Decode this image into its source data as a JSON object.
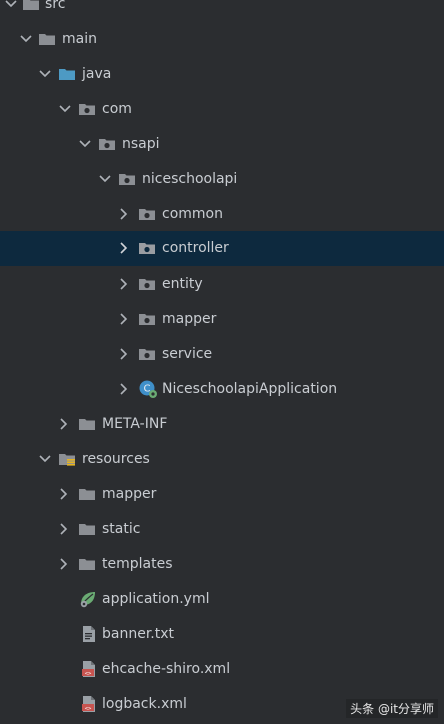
{
  "tree": {
    "items": [
      {
        "label": "src"
      },
      {
        "label": "main"
      },
      {
        "label": "java"
      },
      {
        "label": "com"
      },
      {
        "label": "nsapi"
      },
      {
        "label": "niceschoolapi"
      },
      {
        "label": "common"
      },
      {
        "label": "controller"
      },
      {
        "label": "entity"
      },
      {
        "label": "mapper"
      },
      {
        "label": "service"
      },
      {
        "label": "NiceschoolapiApplication"
      },
      {
        "label": "META-INF"
      },
      {
        "label": "resources"
      },
      {
        "label": "mapper"
      },
      {
        "label": "static"
      },
      {
        "label": "templates"
      },
      {
        "label": "application.yml"
      },
      {
        "label": "banner.txt"
      },
      {
        "label": "ehcache-shiro.xml"
      },
      {
        "label": "logback.xml"
      }
    ]
  },
  "watermark": "头条 @it分享师",
  "colors": {
    "background": "#2b2d30",
    "selection": "#0d293e",
    "folder": "#8c8f94",
    "java_folder": "#4d9ac4",
    "text": "#c9cdd2"
  }
}
